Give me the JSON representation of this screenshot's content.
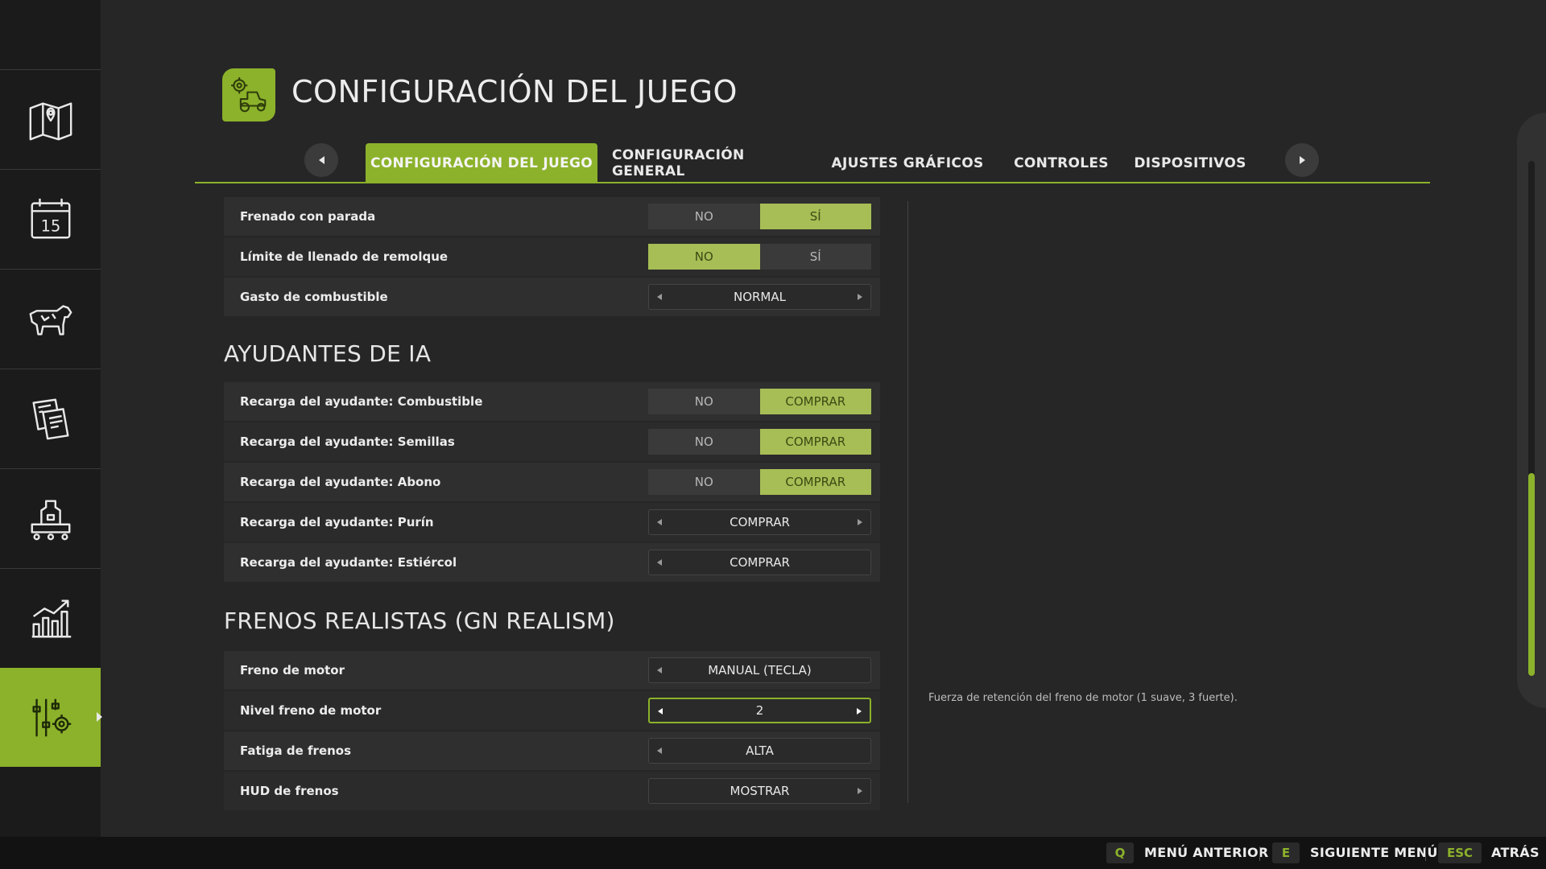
{
  "header": {
    "title": "CONFIGURACIÓN DEL JUEGO",
    "icon": "tractor-gear-icon"
  },
  "sidebar": {
    "items": [
      {
        "icon": "map-pin-icon"
      },
      {
        "icon": "calendar-icon",
        "label": "15"
      },
      {
        "icon": "cow-icon"
      },
      {
        "icon": "documents-icon"
      },
      {
        "icon": "production-icon"
      },
      {
        "icon": "statistics-chart-icon"
      },
      {
        "icon": "settings-sliders-icon",
        "active": true
      }
    ]
  },
  "tabs": [
    {
      "label": "CONFIGURACIÓN DEL JUEGO",
      "active": true
    },
    {
      "label": "CONFIGURACIÓN GENERAL"
    },
    {
      "label": "AJUSTES GRÁFICOS"
    },
    {
      "label": "CONTROLES"
    },
    {
      "label": "DISPOSITIVOS"
    }
  ],
  "settings": {
    "general": [
      {
        "label": "Frenado con parada",
        "type": "toggle",
        "options": [
          "NO",
          "SÍ"
        ],
        "selected": 1
      },
      {
        "label": "Límite de llenado de remolque",
        "type": "toggle",
        "options": [
          "NO",
          "SÍ"
        ],
        "selected": 0
      },
      {
        "label": "Gasto de combustible",
        "type": "selector",
        "value": "NORMAL"
      }
    ],
    "ai_title": "AYUDANTES DE IA",
    "ai": [
      {
        "label": "Recarga del ayudante: Combustible",
        "type": "toggle",
        "options": [
          "NO",
          "COMPRAR"
        ],
        "selected": 1
      },
      {
        "label": "Recarga del ayudante: Semillas",
        "type": "toggle",
        "options": [
          "NO",
          "COMPRAR"
        ],
        "selected": 1
      },
      {
        "label": "Recarga del ayudante: Abono",
        "type": "toggle",
        "options": [
          "NO",
          "COMPRAR"
        ],
        "selected": 1
      },
      {
        "label": "Recarga del ayudante: Purín",
        "type": "selector",
        "value": "COMPRAR"
      },
      {
        "label": "Recarga del ayudante: Estiércol",
        "type": "selector",
        "value": "COMPRAR"
      }
    ],
    "brakes_title": "FRENOS REALISTAS (GN REALISM)",
    "brakes": [
      {
        "label": "Freno de motor",
        "type": "selector",
        "value": "MANUAL (TECLA)"
      },
      {
        "label": "Nivel freno de motor",
        "type": "selector",
        "value": "2",
        "focused": true
      },
      {
        "label": "Fatiga de frenos",
        "type": "selector",
        "value": "ALTA"
      },
      {
        "label": "HUD de frenos",
        "type": "selector",
        "value": "MOSTRAR"
      }
    ]
  },
  "help_text": "Fuerza de retención del freno de motor (1 suave, 3 fuerte).",
  "footer": {
    "prev": {
      "key": "Q",
      "label": "MENÚ ANTERIOR"
    },
    "next": {
      "key": "E",
      "label": "SIGUIENTE MENÚ"
    },
    "back": {
      "key": "ESC",
      "label": "ATRÁS"
    }
  },
  "colors": {
    "accent": "#8cb22b",
    "toggle_on": "#a6be55",
    "background": "#262626",
    "sidebar": "#1b1b1b"
  }
}
